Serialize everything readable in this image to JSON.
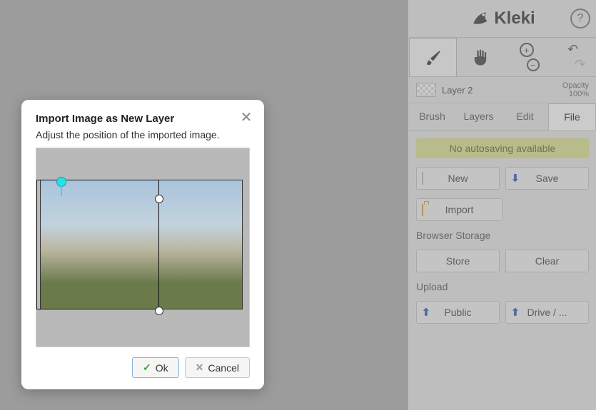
{
  "brand": {
    "name": "Kleki"
  },
  "modal": {
    "title": "Import Image as New Layer",
    "subtitle": "Adjust the position of the imported image.",
    "ok_label": "Ok",
    "cancel_label": "Cancel"
  },
  "layer": {
    "name": "Layer 2",
    "opacity_label": "Opacity",
    "opacity_value": "100%"
  },
  "tabs": {
    "brush": "Brush",
    "layers": "Layers",
    "edit": "Edit",
    "file": "File",
    "active": "file"
  },
  "file_panel": {
    "autosave_msg": "No autosaving available",
    "new_label": "New",
    "save_label": "Save",
    "import_label": "Import",
    "browser_storage_label": "Browser Storage",
    "store_label": "Store",
    "clear_label": "Clear",
    "upload_label": "Upload",
    "public_label": "Public",
    "drive_label": "Drive / ..."
  }
}
